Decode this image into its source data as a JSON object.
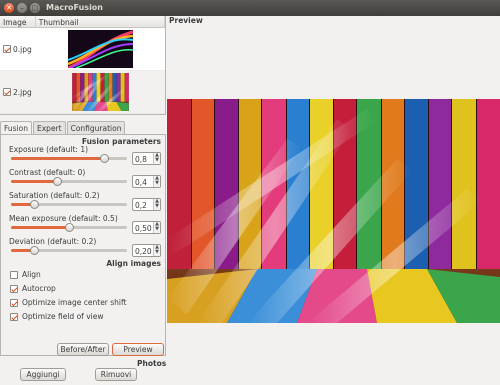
{
  "window": {
    "title": "MacroFusion",
    "close_glyph": "✕",
    "minimize_glyph": "–",
    "maximize_glyph": "□"
  },
  "image_list": {
    "headers": {
      "image": "Image",
      "thumbnail": "Thumbnail"
    },
    "rows": [
      {
        "name": "0.jpg",
        "checked": true
      },
      {
        "name": "2.jpg",
        "checked": true
      }
    ]
  },
  "tabs": [
    {
      "label": "Fusion",
      "active": true
    },
    {
      "label": "Expert",
      "active": false
    },
    {
      "label": "Configuration",
      "active": false
    }
  ],
  "fusion": {
    "section_title": "Fusion parameters",
    "params": [
      {
        "label": "Exposure (default: 1)",
        "value": "0,8",
        "level": 0.8
      },
      {
        "label": "Contrast (default: 0)",
        "value": "0,4",
        "level": 0.4
      },
      {
        "label": "Saturation (default: 0.2)",
        "value": "0,2",
        "level": 0.2
      },
      {
        "label": "Mean exposure (default: 0.5)",
        "value": "0,50",
        "level": 0.5
      },
      {
        "label": "Deviation (default: 0.2)",
        "value": "0,20",
        "level": 0.2
      }
    ]
  },
  "align": {
    "section_title": "Align images",
    "options": [
      {
        "label": "Align",
        "checked": false
      },
      {
        "label": "Autocrop",
        "checked": true
      },
      {
        "label": "Optimize image center shift",
        "checked": true
      },
      {
        "label": "Optimize field of view",
        "checked": true
      }
    ]
  },
  "buttons": {
    "before_after": "Before/After",
    "preview": "Preview",
    "add": "Aggiungi",
    "remove": "Rimuovi"
  },
  "photos_title": "Photos",
  "preview_title": "Preview",
  "colors": {
    "accent": "#e0693e",
    "check": "#d54a1d",
    "titlebar": "#3f3e3a"
  }
}
